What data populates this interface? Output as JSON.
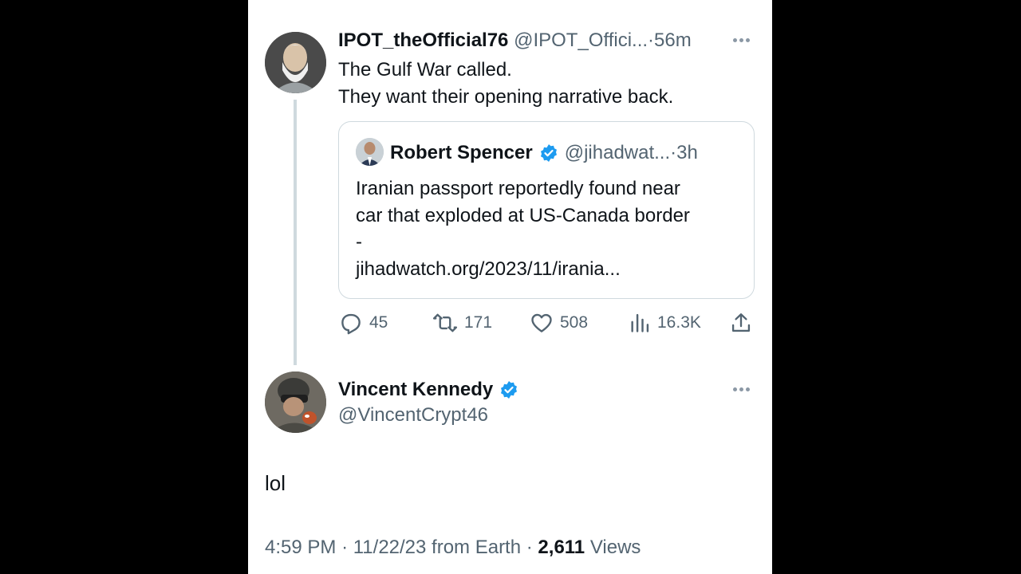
{
  "parent_tweet": {
    "display_name": "IPOT_theOfficial76",
    "handle": "@IPOT_Offici...",
    "separator": "·",
    "time": "56m",
    "lines": [
      "The Gulf War called.",
      "They want their opening narrative back."
    ],
    "quote": {
      "display_name": "Robert Spencer",
      "handle": "@jihadwat...",
      "separator": "·",
      "time": "3h",
      "lines": [
        "Iranian passport reportedly found near",
        "car that exploded at US-Canada border",
        "-",
        "jihadwatch.org/2023/11/irania..."
      ]
    },
    "actions": {
      "replies": "45",
      "reposts": "171",
      "likes": "508",
      "views": "16.3K"
    }
  },
  "reply_tweet": {
    "display_name": "Vincent Kennedy",
    "handle": "@VincentCrypt46",
    "body": "lol",
    "meta": {
      "time": "4:59 PM",
      "sep1": "·",
      "date_source": "11/22/23 from Earth",
      "sep2": "·",
      "views_count": "2,611",
      "views_label": "Views"
    }
  },
  "colors": {
    "background": "#000000",
    "panel": "#ffffff",
    "text": "#0f1419",
    "muted": "#536471",
    "verified": "#1d9bf0",
    "border": "#cfd9de"
  },
  "icons": [
    "more-icon",
    "verified-badge-icon",
    "reply-icon",
    "repost-icon",
    "like-icon",
    "views-icon",
    "share-icon"
  ]
}
